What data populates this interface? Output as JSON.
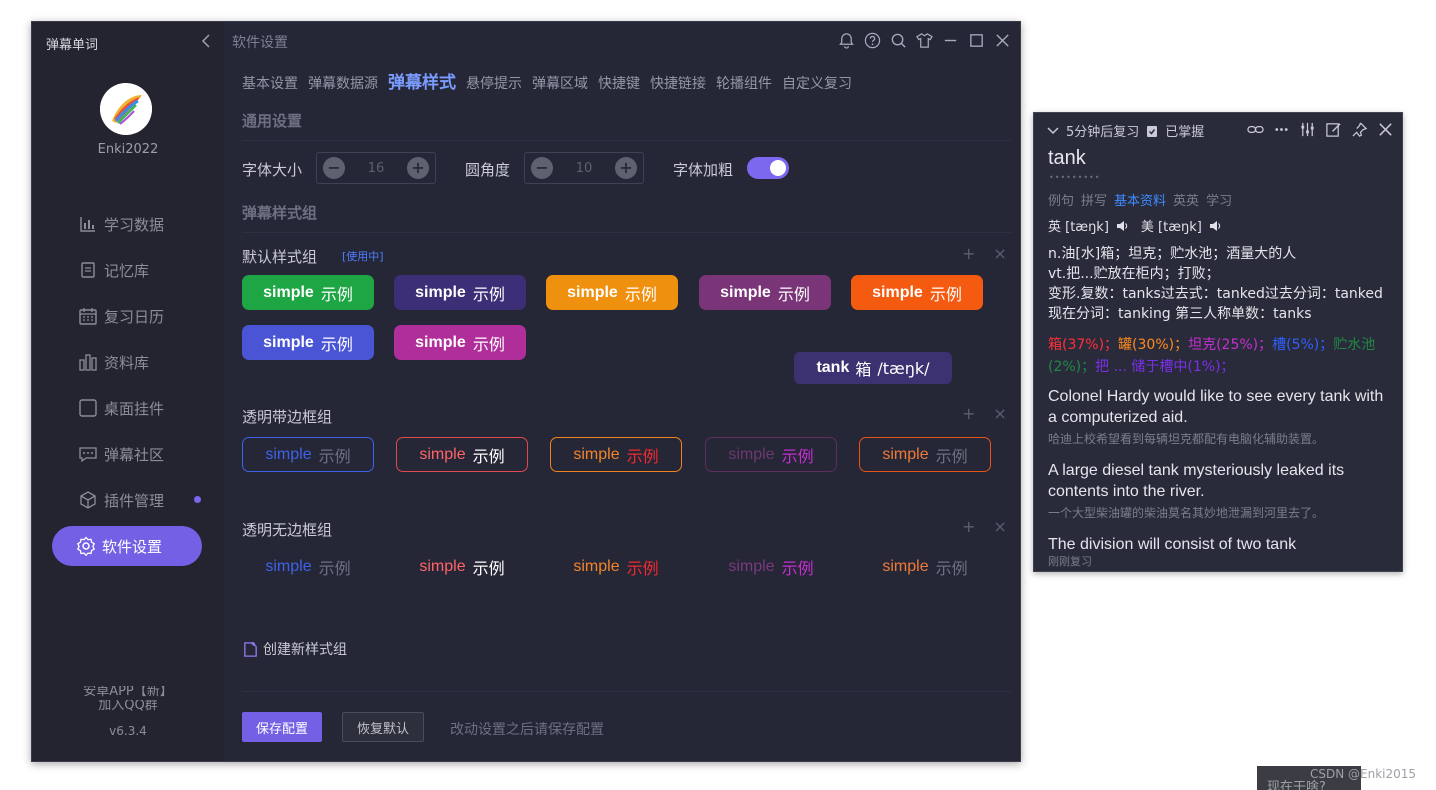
{
  "app": {
    "title": "弹幕单词",
    "username": "Enki2022",
    "version": "v6.3.4",
    "sidebar": [
      {
        "label": "学习数据",
        "icon": "bar-chart-icon"
      },
      {
        "label": "记忆库",
        "icon": "document-icon"
      },
      {
        "label": "复习日历",
        "icon": "calendar-icon"
      },
      {
        "label": "资料库",
        "icon": "library-icon"
      },
      {
        "label": "桌面挂件",
        "icon": "widget-icon"
      },
      {
        "label": "弹幕社区",
        "icon": "chat-icon"
      },
      {
        "label": "插件管理",
        "icon": "cube-icon"
      },
      {
        "label": "软件设置",
        "icon": "gear-icon"
      }
    ],
    "side_footer_1": "安卓APP【新】",
    "side_footer_2": "加入QQ群"
  },
  "header": {
    "title": "软件设置",
    "tabs": [
      "基本设置",
      "弹幕数据源",
      "弹幕样式",
      "悬停提示",
      "弹幕区域",
      "快捷键",
      "快捷链接",
      "轮播组件",
      "自定义复习"
    ],
    "selected_tab": "弹幕样式"
  },
  "general": {
    "heading": "通用设置",
    "font_size_label": "字体大小",
    "font_size_value": "16",
    "radius_label": "圆角度",
    "radius_value": "10",
    "bold_label": "字体加粗",
    "bold_on": true
  },
  "groups": {
    "heading": "弹幕样式组",
    "sample_word": "simple",
    "sample_cn": "示例",
    "default_title": "默认样式组",
    "in_use": "[使用中]",
    "transparent_border_title": "透明带边框组",
    "transparent_noborder_title": "透明无边框组",
    "create": "创建新样式组",
    "default_colors": [
      "#1ea644",
      "#3d2e78",
      "#f0900f",
      "#7a3478",
      "#f45a10",
      "#4a55d6",
      "#b02e9a"
    ],
    "border_styles": [
      {
        "border": "#3e63e8",
        "word": "#3e63e8",
        "cn": "#6e7081"
      },
      {
        "border": "#e0494e",
        "word": "#ff6468",
        "cn": "#ffffff"
      },
      {
        "border": "#f28321",
        "word": "#f4842a",
        "cn": "#f2292e"
      },
      {
        "border": "#5c2f5e",
        "word": "#6c3a6e",
        "cn": "#c42fd2"
      },
      {
        "border": "#e85416",
        "word": "#f07a3a",
        "cn": "#6e7081"
      }
    ],
    "noborder_styles": [
      {
        "word": "#3e63e8",
        "cn": "#6e7081"
      },
      {
        "word": "#ff6468",
        "cn": "#ffffff"
      },
      {
        "word": "#f4842a",
        "cn": "#f2292e"
      },
      {
        "word": "#7a3a7c",
        "cn": "#c42fd2"
      },
      {
        "word": "#f07a3a",
        "cn": "#6e7081"
      }
    ]
  },
  "tooltip": {
    "word": "tank",
    "cn": "箱",
    "phonetic": "/tæŋk/"
  },
  "footer": {
    "save": "保存配置",
    "reset": "恢复默认",
    "hint": "改动设置之后请保存配置"
  },
  "card": {
    "review": "5分钟后复习",
    "mastered": "已掌握",
    "word": "tank",
    "dots": "•••••••••",
    "tabs": [
      "例句",
      "拼写",
      "基本资料",
      "英英",
      "学习"
    ],
    "active_tab": "基本资料",
    "uk": "英 [tæŋk]",
    "us": "美 [tæŋk]",
    "defs": [
      "n.油[水]箱；坦克；贮水池；酒量大的人",
      "vt.把...贮放在柜内；打败；",
      "变形.复数：tanks过去式：tanked过去分词：tanked现在分词：tanking 第三人称单数：tanks"
    ],
    "freq": [
      {
        "text": "箱(37%)；",
        "color": "#ff2f38"
      },
      {
        "text": "罐(30%)；",
        "color": "#ff8a1e"
      },
      {
        "text": "坦克(25%)；",
        "color": "#c42fd2"
      },
      {
        "text": "槽(5%)；",
        "color": "#2f5fff"
      },
      {
        "text": "贮水池(2%)；",
        "color": "#1f8a44"
      },
      {
        "text": "把 ... 储于槽中(1%)；",
        "color": "#7a2fe8"
      }
    ],
    "examples": [
      {
        "en": "Colonel Hardy would like to see every tank with a computerized aid.",
        "zh": "哈迪上校希望看到每辆坦克都配有电脑化辅助装置。"
      },
      {
        "en": "A large diesel tank mysteriously leaked its contents into the river.",
        "zh": "一个大型柴油罐的柴油莫名其妙地泄漏到河里去了。"
      },
      {
        "en": "The division will consist of two tank",
        "zh": ""
      }
    ],
    "footer": "刚刚复习"
  },
  "watermark": "CSDN @Enki2015",
  "dark_tab": "现在干啥?"
}
